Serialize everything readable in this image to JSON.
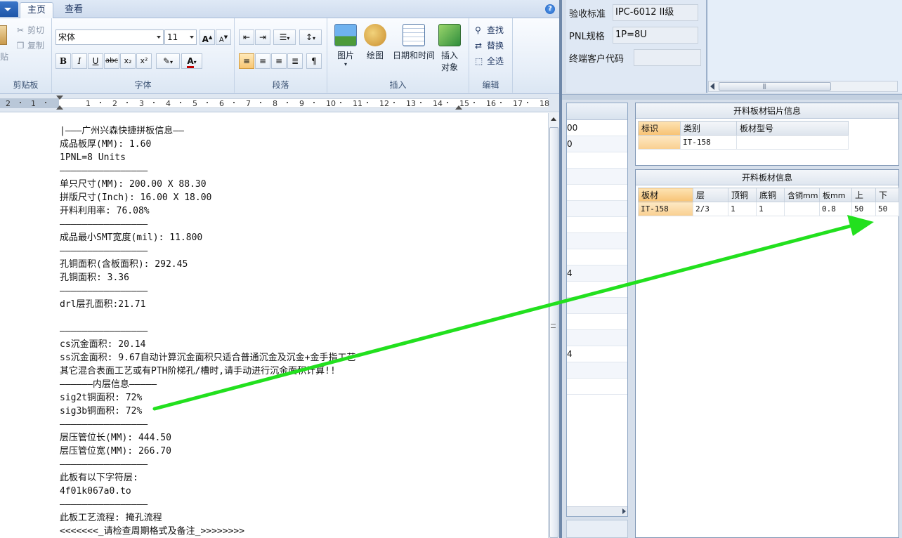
{
  "bg": {
    "form": [
      {
        "label": "验收标准",
        "value": "IPC-6012 II级"
      },
      {
        "label": "PNL规格",
        "value": "1P=8U"
      },
      {
        "label": "终端客户代码",
        "value": ""
      }
    ],
    "left_grid_rows": [
      "00",
      "0",
      "",
      "",
      "",
      "",
      "",
      "",
      "",
      "4",
      "",
      "",
      "",
      "",
      "4",
      "",
      ""
    ],
    "panel1": {
      "title": "开料板材铝片信息",
      "headers": [
        "标识",
        "类别",
        "板材型号"
      ],
      "row": [
        "",
        "IT-158",
        ""
      ]
    },
    "panel2": {
      "title": "开料板材信息",
      "headers": [
        "板材",
        "层",
        "顶铜",
        "底铜",
        "含铜mm",
        "板mm",
        "上",
        "下"
      ],
      "row": [
        "IT-158",
        "2/3",
        "1",
        "1",
        "",
        "0.8",
        "50",
        "50"
      ]
    }
  },
  "word": {
    "tabs": [
      "主页",
      "查看"
    ],
    "help": "?",
    "clipboard": {
      "paste": "贴",
      "cut": "剪切",
      "copy": "复制",
      "group": "剪贴板"
    },
    "font": {
      "family": "宋体",
      "size": "11",
      "grow": "A",
      "shrink": "A",
      "bold": "B",
      "italic": "I",
      "underline": "U",
      "strike": "abc",
      "sub": "x₂",
      "sup": "x²",
      "group": "字体"
    },
    "paragraph": {
      "group": "段落"
    },
    "insert": {
      "picture": "图片",
      "paint": "绘图",
      "datetime": "日期和时间",
      "object_line1": "插入",
      "object_line2": "对象",
      "group": "插入"
    },
    "editing": {
      "find": "查找",
      "replace": "替换",
      "selectall": "全选",
      "group": "编辑"
    },
    "ruler_ticks": [
      "2",
      "1",
      "1",
      "2",
      "3",
      "4",
      "5",
      "6",
      "7",
      "8",
      "9",
      "10",
      "11",
      "12",
      "13",
      "14",
      "15",
      "16",
      "17",
      "18"
    ],
    "doc_lines": [
      "|———广州兴森快捷拼板信息——",
      "成品板厚(MM): 1.60",
      "1PNL=8 Units",
      "————————————————",
      "单只尺寸(MM): 200.00 X 88.30",
      "拼版尺寸(Inch): 16.00 X 18.00",
      "开料利用率: 76.08%",
      "————————————————",
      "成品最小SMT宽度(mil): 11.800",
      "————————————————",
      "孔铜面积(含板面积): 292.45",
      "孔铜面积: 3.36",
      "————————————————",
      "drl层孔面积:21.71",
      "",
      "————————————————",
      "cs沉金面积: 20.14",
      "ss沉金面积: 9.67自动计算沉金面积只适合普通沉金及沉金+金手指工艺",
      "其它混合表面工艺或有PTH阶梯孔/槽时,请手动进行沉金面积计算!!",
      "——————内层信息—————",
      "sig2t铜面积: 72%",
      "sig3b铜面积: 72%",
      "————————————————",
      "层压管位长(MM): 444.50",
      "层压管位宽(MM): 266.70",
      "————————————————",
      "此板有以下字符层:",
      "4f01k067a0.to",
      "————————————————",
      "此板工艺流程: 掩孔流程",
      "<<<<<<<_请检查周期格式及备注_>>>>>>>>"
    ]
  },
  "colors": {
    "arrow": "#22e01e",
    "selected_header": "#f7c274",
    "accent": "#1f56a8"
  }
}
